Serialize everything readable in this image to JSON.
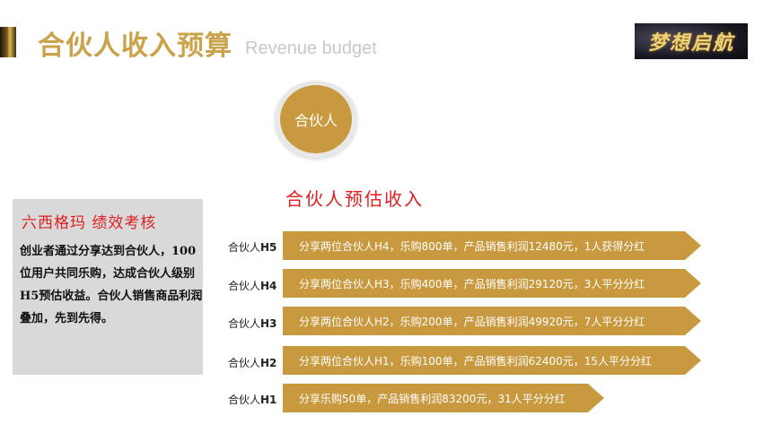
{
  "header": {
    "title": "合伙人收入预算",
    "subtitle": "Revenue budget",
    "logo_text": "梦想启航"
  },
  "badge": {
    "label": "合伙人"
  },
  "section_title": "合伙人预估收入",
  "info_box": {
    "heading": "六西格玛 绩效考核",
    "body": "创业者通过分享达到合伙人，100位用户共同乐购，达成合伙人级别H5预估收益。合伙人销售商品利润叠加，先到先得。"
  },
  "tiers": [
    {
      "prefix": "合伙人",
      "level": "H5",
      "text": "分享两位合伙人H4，乐购800单，产品销售利润12480元，1人获得分红"
    },
    {
      "prefix": "合伙人",
      "level": "H4",
      "text": "分享两位合伙人H3，乐购400单，产品销售利润29120元，3人平分分红"
    },
    {
      "prefix": "合伙人",
      "level": "H3",
      "text": "分享两位合伙人H2，乐购200单，产品销售利润49920元，7人平分分红"
    },
    {
      "prefix": "合伙人",
      "level": "H2",
      "text": "分享两位合伙人H1，乐购100单，产品销售利润62400元，15人平分分红"
    },
    {
      "prefix": "合伙人",
      "level": "H1",
      "text": "分享乐购50单，产品销售利润83200元，31人平分分红"
    }
  ],
  "colors": {
    "gold": "#c8993e",
    "title_gold": "#c9a24a",
    "accent_red": "#e02020",
    "box_gray": "#d9d9d9"
  }
}
